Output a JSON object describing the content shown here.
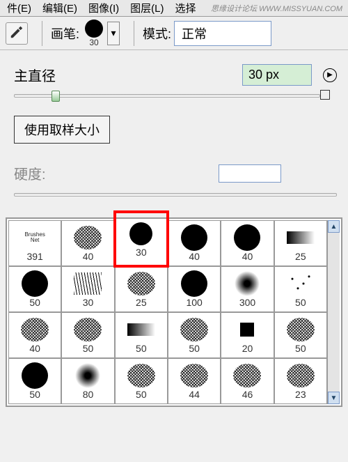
{
  "menubar": [
    "件(E)",
    "编辑(E)",
    "图像(I)",
    "图层(L)",
    "选择"
  ],
  "watermark": "思缘设计论坛 WWW.MISSYUAN.COM",
  "options": {
    "brush_label": "画笔:",
    "brush_size": "30",
    "mode_label": "模式:",
    "mode_value": "正常"
  },
  "panel": {
    "diameter_label": "主直径",
    "diameter_value": "30 px",
    "sample_button": "使用取样大小",
    "hardness_label": "硬度:"
  },
  "chart_data": {
    "type": "table",
    "title": "Brush presets grid",
    "rows": [
      [
        {
          "n": 391,
          "t": "text"
        },
        {
          "n": 40,
          "t": "noise"
        },
        {
          "n": 30,
          "t": "circle",
          "sel": true,
          "hl": true
        },
        {
          "n": 40,
          "t": "circle"
        },
        {
          "n": 40,
          "t": "circle"
        },
        {
          "n": 25,
          "t": "smear"
        }
      ],
      [
        {
          "n": 50,
          "t": "circle"
        },
        {
          "n": 30,
          "t": "scribble"
        },
        {
          "n": 25,
          "t": "noise"
        },
        {
          "n": 100,
          "t": "circle"
        },
        {
          "n": 300,
          "t": "soft"
        },
        {
          "n": 50,
          "t": "dots"
        }
      ],
      [
        {
          "n": 40,
          "t": "noise"
        },
        {
          "n": 50,
          "t": "noise"
        },
        {
          "n": 50,
          "t": "smear"
        },
        {
          "n": 50,
          "t": "noise"
        },
        {
          "n": 20,
          "t": "square"
        },
        {
          "n": 50,
          "t": "noise"
        }
      ],
      [
        {
          "n": 50,
          "t": "circle"
        },
        {
          "n": 80,
          "t": "soft"
        },
        {
          "n": 50,
          "t": "noise"
        },
        {
          "n": 44,
          "t": "noise"
        },
        {
          "n": 46,
          "t": "noise"
        },
        {
          "n": 23,
          "t": "noise"
        }
      ]
    ]
  }
}
